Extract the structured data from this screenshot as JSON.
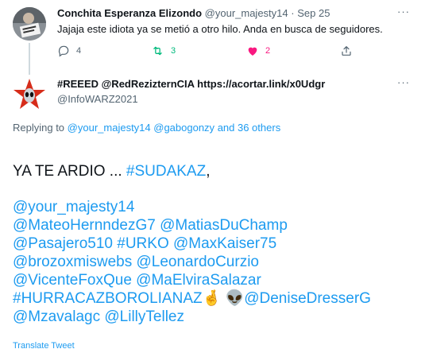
{
  "reply": {
    "author_name": "Conchita Esperanza Elizondo",
    "author_handle": "@your_majesty14",
    "separator": "·",
    "date": "Sep 25",
    "text": "Jajaja este idiota ya se metió a otro hilo. Anda en busca de seguidores.",
    "replies_count": "4",
    "retweets_count": "3",
    "likes_count": "2",
    "more_label": "···"
  },
  "tweet": {
    "author_name": "#REEED @RedRezizternCIA https://acortar.link/x0Udgr",
    "author_handle": "@InfoWARZ2021",
    "more_label": "···",
    "replying_prefix": "Replying to",
    "replying_users": "@your_majesty14 @gabogonzy",
    "replying_suffix": "and 36 others",
    "body": {
      "line1_text": "YA TE ARDIO ... ",
      "line1_tag": "#SUDAKAZ",
      "line1_end": ",",
      "mentions_1": "@your_majesty14",
      "mentions_2": "@MateoHernndezG7 @MatiasDuChamp",
      "mentions_3": "@Pasajero510 #URKO @MaxKaiser75",
      "mentions_4": "@brozoxmiswebs @LeonardoCurzio",
      "mentions_5": "@VicenteFoxQue @MaElviraSalazar",
      "mentions_6_tag": "#HURRACAZBOROLIANAZ",
      "mentions_6_emoji": "🤞 👽",
      "mentions_6_user": "@DeniseDresserG",
      "mentions_7": "@Mzavalagc @LillyTellez"
    },
    "translate_label": "Translate Tweet"
  },
  "colors": {
    "link": "#1d9bf0",
    "muted": "#536471",
    "like": "#f91880",
    "retweet": "#00ba7c",
    "text": "#0f1419"
  }
}
